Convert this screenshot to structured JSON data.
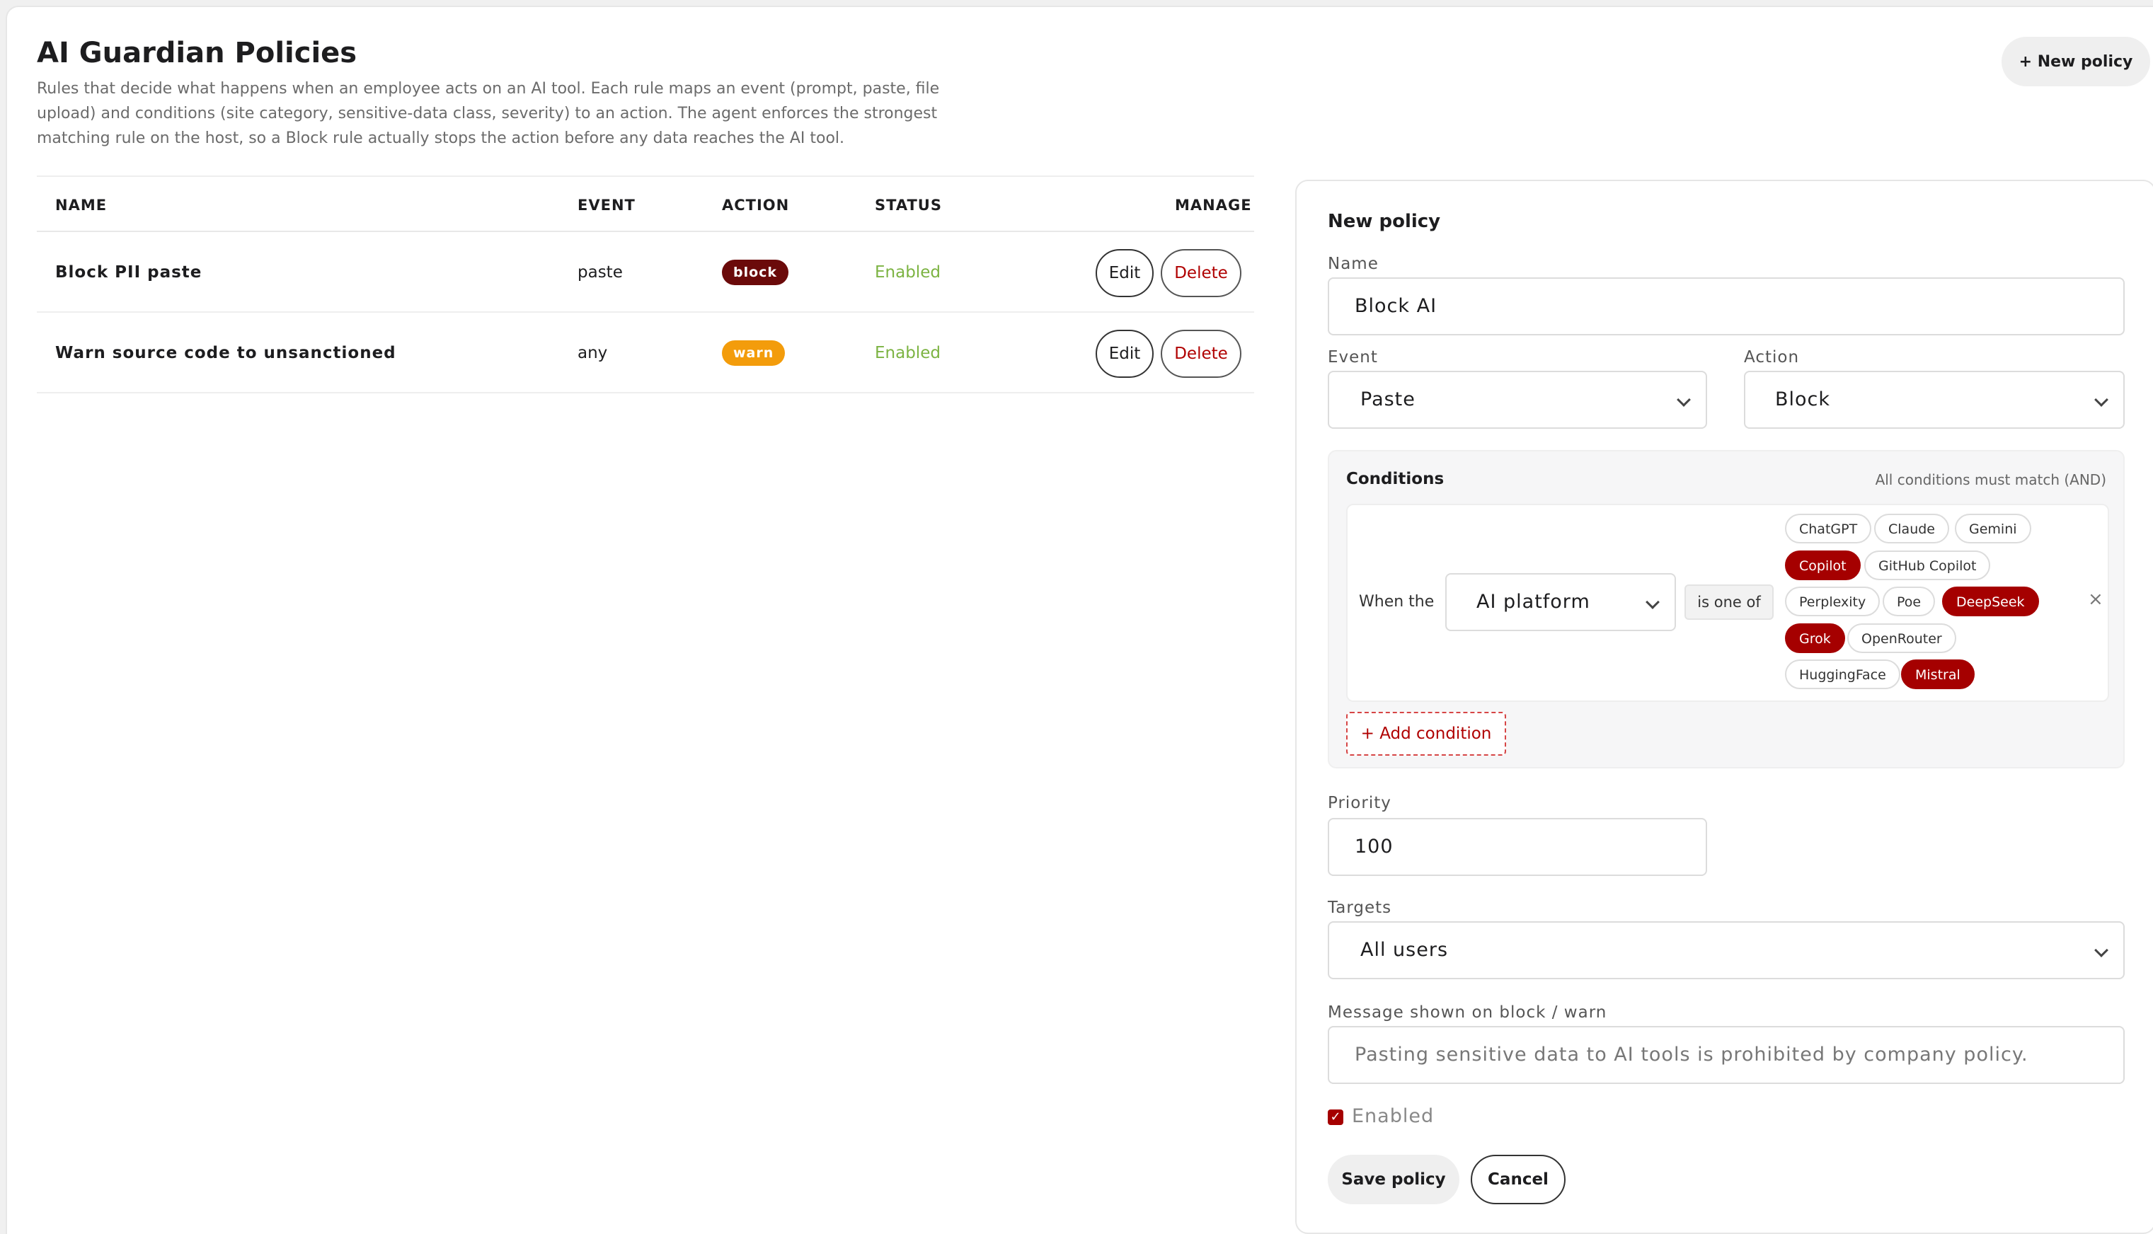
{
  "header": {
    "title": "AI Guardian Policies",
    "description": "Rules that decide what happens when an employee acts on an AI tool. Each rule maps an event (prompt, paste, file upload) and conditions (site category, sensitive-data class, severity) to an action. The agent enforces the strongest matching rule on the host, so a Block rule actually stops the action before any data reaches the AI tool.",
    "new_policy_label": "+ New policy"
  },
  "table": {
    "columns": [
      "NAME",
      "EVENT",
      "ACTION",
      "STATUS",
      "MANAGE"
    ],
    "rows": [
      {
        "name": "Block PII paste",
        "event": "paste",
        "action": "block",
        "status": "Enabled",
        "edit": "Edit",
        "delete": "Delete"
      },
      {
        "name": "Warn source code to unsanctioned",
        "event": "any",
        "action": "warn",
        "status": "Enabled",
        "edit": "Edit",
        "delete": "Delete"
      }
    ]
  },
  "form": {
    "title": "New policy",
    "name_label": "Name",
    "name_value": "Block AI",
    "event_label": "Event",
    "event_value": "Paste",
    "action_label": "Action",
    "action_value": "Block",
    "conditions": {
      "title": "Conditions",
      "note": "All conditions must match (AND)",
      "when_label": "When the",
      "field_value": "AI platform",
      "operator": "is one of",
      "remove": "×",
      "chips": [
        {
          "label": "ChatGPT",
          "selected": false
        },
        {
          "label": "Claude",
          "selected": false
        },
        {
          "label": "Gemini",
          "selected": false
        },
        {
          "label": "Copilot",
          "selected": true
        },
        {
          "label": "GitHub Copilot",
          "selected": false
        },
        {
          "label": "Perplexity",
          "selected": false
        },
        {
          "label": "Poe",
          "selected": false
        },
        {
          "label": "DeepSeek",
          "selected": true
        },
        {
          "label": "Grok",
          "selected": true
        },
        {
          "label": "OpenRouter",
          "selected": false
        },
        {
          "label": "HuggingFace",
          "selected": false
        },
        {
          "label": "Mistral",
          "selected": true
        }
      ],
      "add_label": "+ Add condition"
    },
    "priority_label": "Priority",
    "priority_value": "100",
    "targets_label": "Targets",
    "targets_value": "All users",
    "message_label": "Message shown on block / warn",
    "message_placeholder": "Pasting sensitive data to AI tools is prohibited by company policy.",
    "enabled_label": "Enabled",
    "enabled": true,
    "save_label": "Save policy",
    "cancel_label": "Cancel"
  },
  "colors": {
    "accent": "#a50000",
    "block_badge": "#6b0a0a",
    "warn_badge": "#f39c0b",
    "enabled_status": "#7cb342"
  }
}
